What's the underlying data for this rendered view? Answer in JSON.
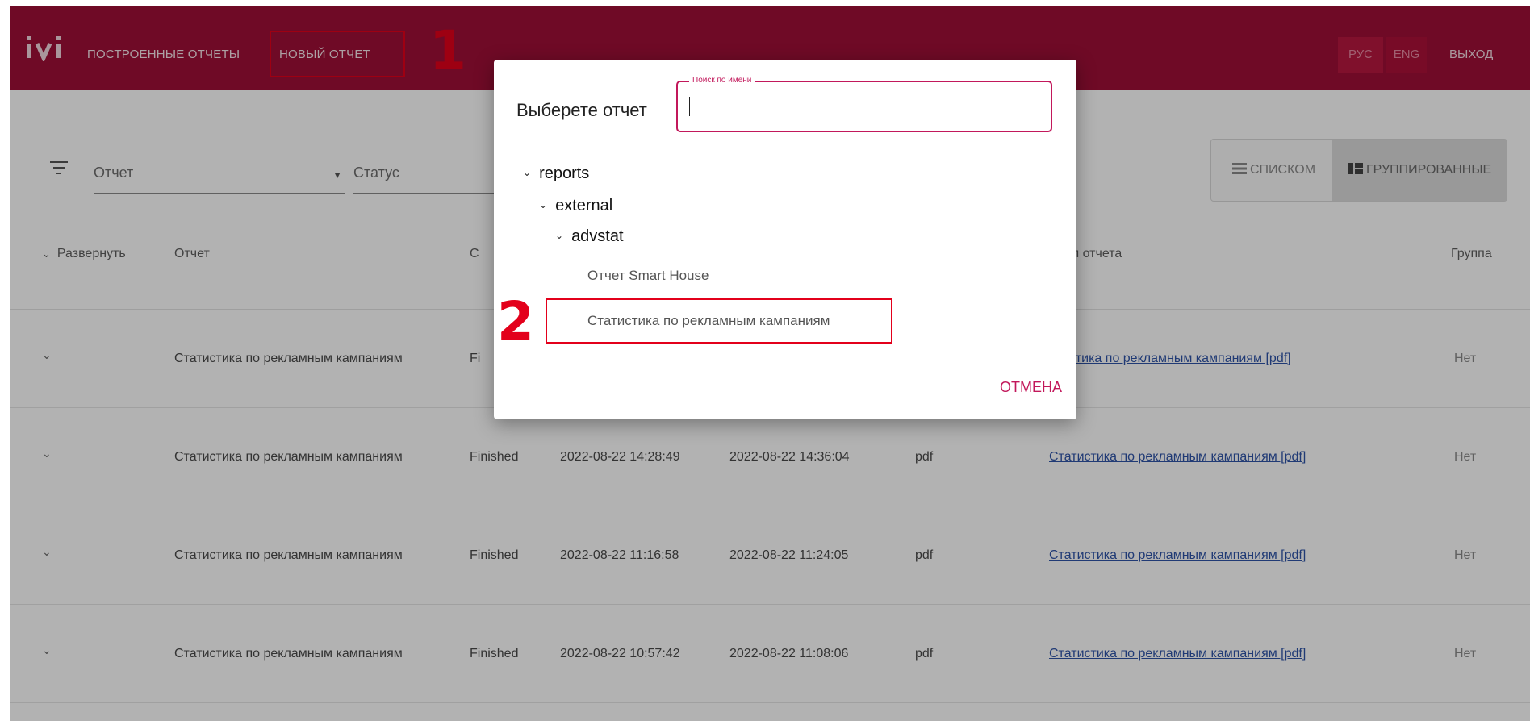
{
  "header": {
    "nav_reports": "ПОСТРОЕННЫЕ ОТЧЕТЫ",
    "nav_new_report": "НОВЫЙ ОТЧЕТ",
    "lang_ru": "РУС",
    "lang_en": "ENG",
    "logout": "ВЫХОД",
    "accent_color": "#a00f37"
  },
  "annotations": {
    "step1": "1",
    "step2": "2",
    "color": "#e3001b"
  },
  "filters": {
    "report_label": "Отчет",
    "status_label": "Статус",
    "view_list": "СПИСКОМ",
    "view_grouped": "ГРУППИРОВАННЫЕ"
  },
  "table": {
    "columns": {
      "expand": "Развернуть",
      "report": "Отчет",
      "status": "С",
      "file": "айл отчета",
      "group": "Группа"
    },
    "rows": [
      {
        "report": "Статистика по рекламным кампаниям",
        "status": "Fi",
        "start": "",
        "end": "",
        "format": "",
        "file": "атистика по рекламным кампаниям [pdf]",
        "group": "Нет"
      },
      {
        "report": "Статистика по рекламным кампаниям",
        "status": "Finished",
        "start": "2022-08-22 14:28:49",
        "end": "2022-08-22 14:36:04",
        "format": "pdf",
        "file": "Статистика по рекламным кампаниям [pdf]",
        "group": "Нет"
      },
      {
        "report": "Статистика по рекламным кампаниям",
        "status": "Finished",
        "start": "2022-08-22 11:16:58",
        "end": "2022-08-22 11:24:05",
        "format": "pdf",
        "file": "Статистика по рекламным кампаниям [pdf]",
        "group": "Нет"
      },
      {
        "report": "Статистика по рекламным кампаниям",
        "status": "Finished",
        "start": "2022-08-22 10:57:42",
        "end": "2022-08-22 11:08:06",
        "format": "pdf",
        "file": "Статистика по рекламным кампаниям [pdf]",
        "group": "Нет"
      }
    ]
  },
  "dialog": {
    "title": "Выберете отчет",
    "search_legend": "Поиск по имени",
    "search_value": "",
    "tree": {
      "root": "reports",
      "child": "external",
      "grandchild": "advstat",
      "leaves": [
        "Отчет Smart House",
        "Статистика по рекламным кампаниям"
      ]
    },
    "cancel": "ОТМЕНА"
  }
}
